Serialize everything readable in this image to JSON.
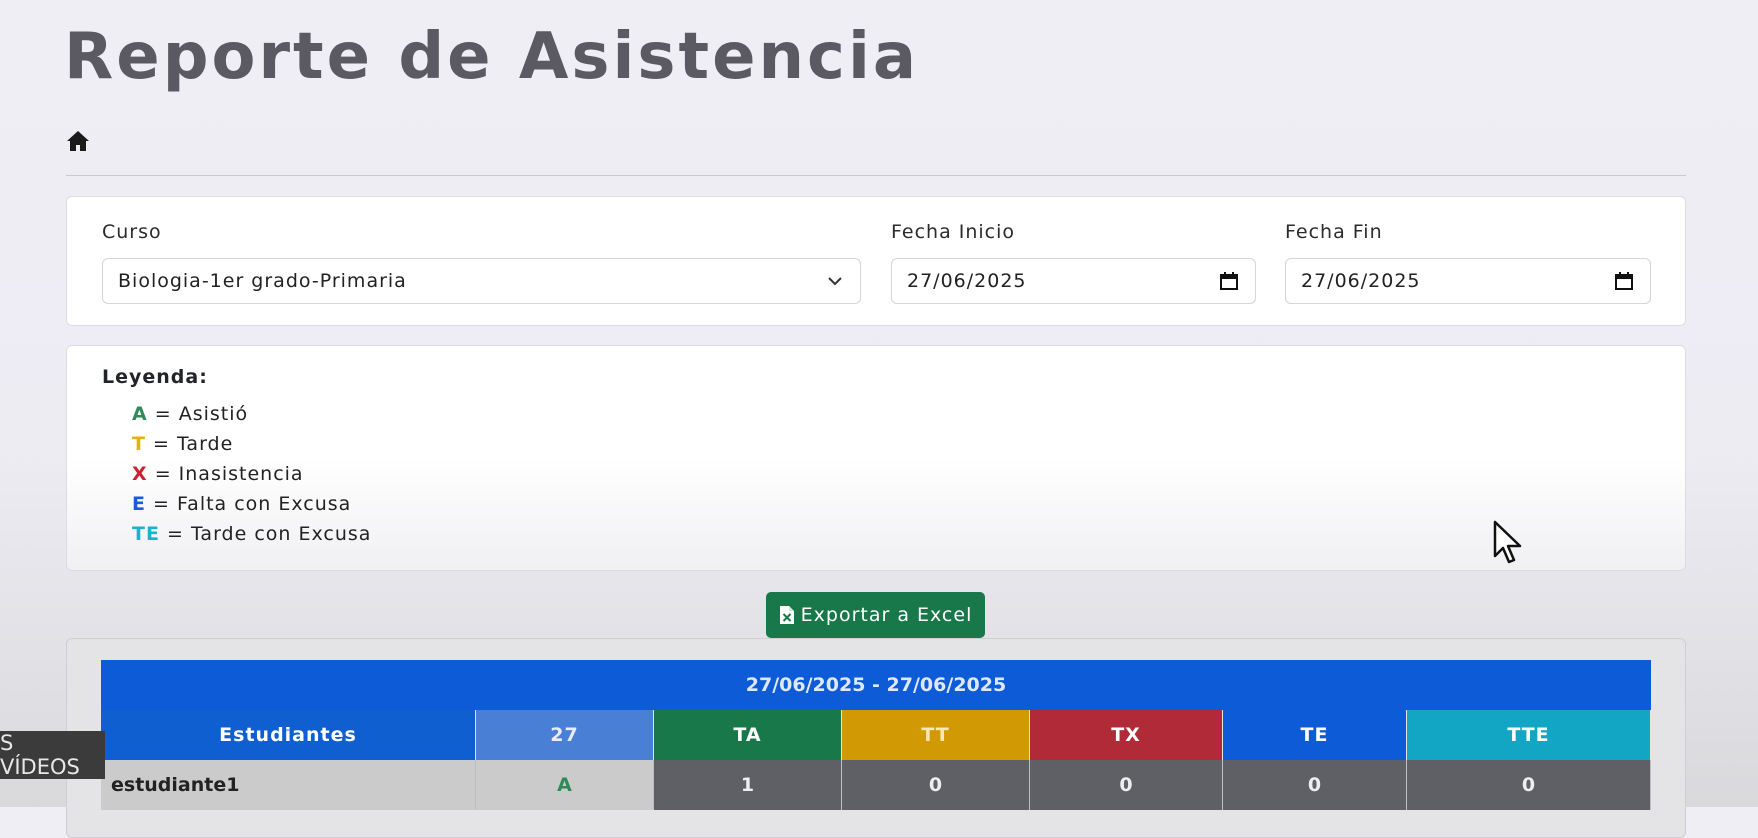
{
  "page": {
    "title": "Reporte de Asistencia"
  },
  "filters": {
    "curso_label": "Curso",
    "curso_value": "Biologia-1er grado-Primaria",
    "fecha_inicio_label": "Fecha Inicio",
    "fecha_inicio_value": "27/06/2025",
    "fecha_fin_label": "Fecha Fin",
    "fecha_fin_value": "27/06/2025"
  },
  "legend": {
    "title": "Leyenda:",
    "items": [
      {
        "code": "A",
        "text": "= Asistió",
        "color": "#2e8b57"
      },
      {
        "code": "T",
        "text": "= Tarde",
        "color": "#e6b400"
      },
      {
        "code": "X",
        "text": "= Inasistencia",
        "color": "#c82333"
      },
      {
        "code": "E",
        "text": "= Falta con Excusa",
        "color": "#1a5ce0"
      },
      {
        "code": "TE",
        "text": "= Tarde con Excusa",
        "color": "#17b3d1"
      }
    ]
  },
  "export_label": "Exportar a Excel",
  "table": {
    "range": "27/06/2025 - 27/06/2025",
    "headers": {
      "students": "Estudiantes",
      "day": "27",
      "ta": "TA",
      "tt": "TT",
      "tx": "TX",
      "te": "TE",
      "tte": "TTE"
    },
    "rows": [
      {
        "name": "estudiante1",
        "day": "A",
        "ta": "1",
        "tt": "0",
        "tx": "0",
        "te": "0",
        "tte": "0"
      }
    ]
  },
  "overlay": {
    "videos_label": "S VÍDEOS"
  },
  "colors": {
    "primary": "#0d5bd6",
    "success": "#19784a",
    "warning": "#d19a05",
    "danger": "#b02a37",
    "info": "#12a5c4"
  }
}
